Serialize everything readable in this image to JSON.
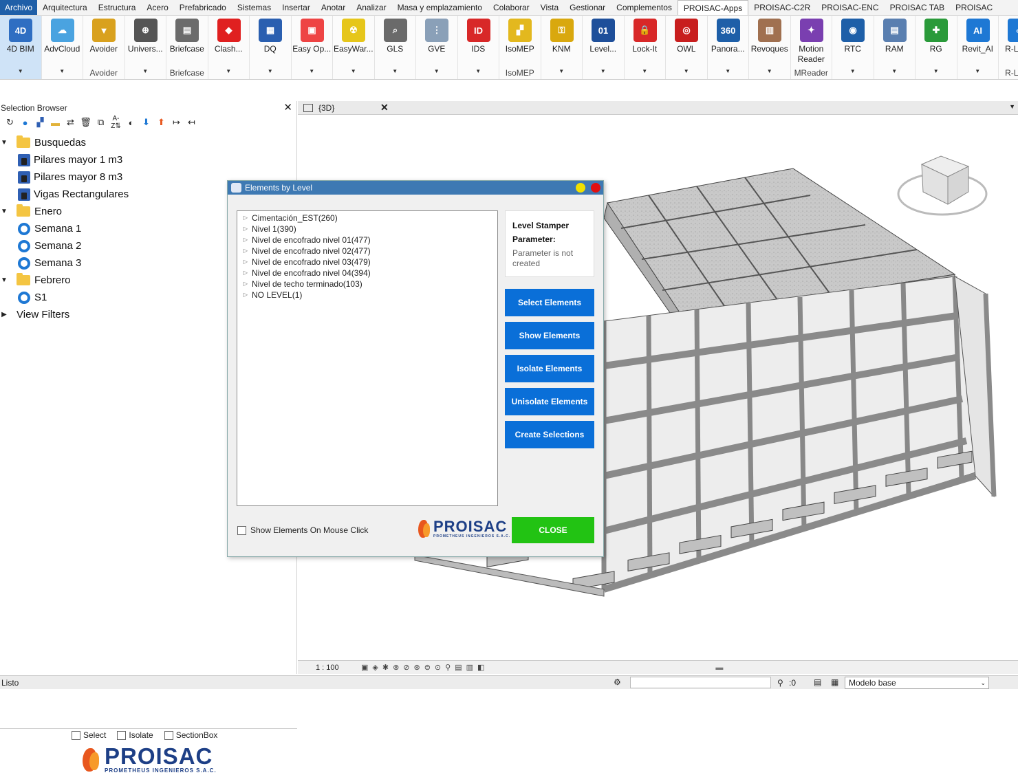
{
  "menu": [
    "Archivo",
    "Arquitectura",
    "Estructura",
    "Acero",
    "Prefabricado",
    "Sistemas",
    "Insertar",
    "Anotar",
    "Analizar",
    "Masa y emplazamiento",
    "Colaborar",
    "Vista",
    "Gestionar",
    "Complementos",
    "PROISAC-Apps",
    "PROISAC-C2R",
    "PROISAC-ENC",
    "PROISAC TAB",
    "PROISAC"
  ],
  "ribbon": [
    {
      "label": "4D BIM",
      "icon": "4d-bim-icon",
      "color": "#2f6ec2",
      "glyph": "4D"
    },
    {
      "label": "AdvCloud",
      "icon": "cloud-icon",
      "color": "#4aa3e0",
      "glyph": "☁"
    },
    {
      "label": "Avoider",
      "icon": "avoider-icon",
      "color": "#d9a11e",
      "glyph": "▼",
      "group": "Avoider"
    },
    {
      "label": "Univers...",
      "icon": "globe-icon",
      "color": "#555555",
      "glyph": "⊕"
    },
    {
      "label": "Briefcase",
      "icon": "briefcase-icon",
      "color": "#6b6b6b",
      "glyph": "▤",
      "group": "Briefcase"
    },
    {
      "label": "Clash...",
      "icon": "clash-icon",
      "color": "#e02020",
      "glyph": "◆"
    },
    {
      "label": "DQ",
      "icon": "dq-icon",
      "color": "#2a5fb0",
      "glyph": "▦"
    },
    {
      "label": "Easy Op...",
      "icon": "easy-op-icon",
      "color": "#e44",
      "glyph": "▣"
    },
    {
      "label": "EasyWar...",
      "icon": "radiation-icon",
      "color": "#e6c61a",
      "glyph": "☢"
    },
    {
      "label": "GLS",
      "icon": "gls-icon",
      "color": "#6a6a6a",
      "glyph": "⌕"
    },
    {
      "label": "GVE",
      "icon": "gve-icon",
      "color": "#8aa0b8",
      "glyph": "⋮"
    },
    {
      "label": "IDS",
      "icon": "ids-icon",
      "color": "#d82828",
      "glyph": "ID"
    },
    {
      "label": "IsoMEP",
      "icon": "isomep-icon",
      "color": "#e3b81e",
      "glyph": "▞",
      "group": "IsoMEP"
    },
    {
      "label": "KNM",
      "icon": "key-icon",
      "color": "#d9a80e",
      "glyph": "⚿"
    },
    {
      "label": "Level...",
      "icon": "level-icon",
      "color": "#1e4f9a",
      "glyph": "01"
    },
    {
      "label": "Lock-It",
      "icon": "lock-icon",
      "color": "#d82828",
      "glyph": "🔒"
    },
    {
      "label": "OWL",
      "icon": "owl-icon",
      "color": "#c81e1e",
      "glyph": "◎"
    },
    {
      "label": "Panora...",
      "icon": "panorama-360-icon",
      "color": "#1e5fa8",
      "glyph": "360"
    },
    {
      "label": "Revoques",
      "icon": "revoques-icon",
      "color": "#a07050",
      "glyph": "▥"
    },
    {
      "label": "Motion Reader",
      "icon": "motion-reader-icon",
      "color": "#7a3fb0",
      "glyph": "✦",
      "group": "MReader"
    },
    {
      "label": "RTC",
      "icon": "rtc-icon",
      "color": "#1e5fa8",
      "glyph": "◉"
    },
    {
      "label": "RAM",
      "icon": "ram-icon",
      "color": "#5a7fb0",
      "glyph": "▤"
    },
    {
      "label": "RG",
      "icon": "gamepad-icon",
      "color": "#2a9a3a",
      "glyph": "✚"
    },
    {
      "label": "Revit_AI",
      "icon": "ai-icon",
      "color": "#1e78d4",
      "glyph": "AI"
    },
    {
      "label": "R-Linke",
      "icon": "link-icon",
      "color": "#1e78d4",
      "glyph": "∞",
      "group": "R-Linke"
    }
  ],
  "selection_browser": {
    "title": "Selection Browser",
    "tree": [
      {
        "label": "Busquedas",
        "type": "folder",
        "level": 0
      },
      {
        "label": "Pilares mayor 1 m3",
        "type": "search",
        "level": 1
      },
      {
        "label": "Pilares mayor 8 m3",
        "type": "search",
        "level": 1
      },
      {
        "label": "Vigas Rectangulares",
        "type": "search",
        "level": 1
      },
      {
        "label": "Enero",
        "type": "folder",
        "level": 0
      },
      {
        "label": "Semana 1",
        "type": "set",
        "level": 1
      },
      {
        "label": "Semana 2",
        "type": "set",
        "level": 1
      },
      {
        "label": "Semana 3",
        "type": "set",
        "level": 1
      },
      {
        "label": "Febrero",
        "type": "folder",
        "level": 0
      },
      {
        "label": "S1",
        "type": "set",
        "level": 1
      },
      {
        "label": "View Filters",
        "type": "item",
        "level": 0
      }
    ],
    "checkboxes": [
      "Select",
      "Isolate",
      "SectionBox"
    ],
    "logo_text": "PROISAC",
    "logo_sub": "PROMETHEUS INGENIEROS S.A.C."
  },
  "view": {
    "tab": "{3D}",
    "scale": "1 : 100"
  },
  "status": {
    "left": "Listo",
    "selection_count": ":0",
    "model": "Modelo base"
  },
  "dialog": {
    "title": "Elements by Level",
    "levels": [
      "Cimentación_EST(260)",
      "Nivel 1(390)",
      "Nivel de encofrado nivel 01(477)",
      "Nivel de encofrado nivel 02(477)",
      "Nivel de encofrado nivel 03(479)",
      "Nivel de encofrado nivel 04(394)",
      "Nivel de techo terminado(103)",
      "NO LEVEL(1)"
    ],
    "info_heading_1": "Level Stamper",
    "info_heading_2": "Parameter:",
    "info_status": "Parameter is not created",
    "buttons": [
      "Select Elements",
      "Show Elements",
      "Isolate Elements",
      "Unisolate Elements",
      "Create Selections"
    ],
    "close": "CLOSE",
    "checkbox": "Show Elements On Mouse Click",
    "logo_text": "PROISAC",
    "logo_sub": "PROMETHEUS INGENIEROS S.A.C."
  },
  "colors": {
    "accent": "#0a6fd8",
    "title_bar": "#3e79b3",
    "close_green": "#22c313",
    "brand_blue": "#1d3f86",
    "brand_orange": "#e8571e"
  }
}
